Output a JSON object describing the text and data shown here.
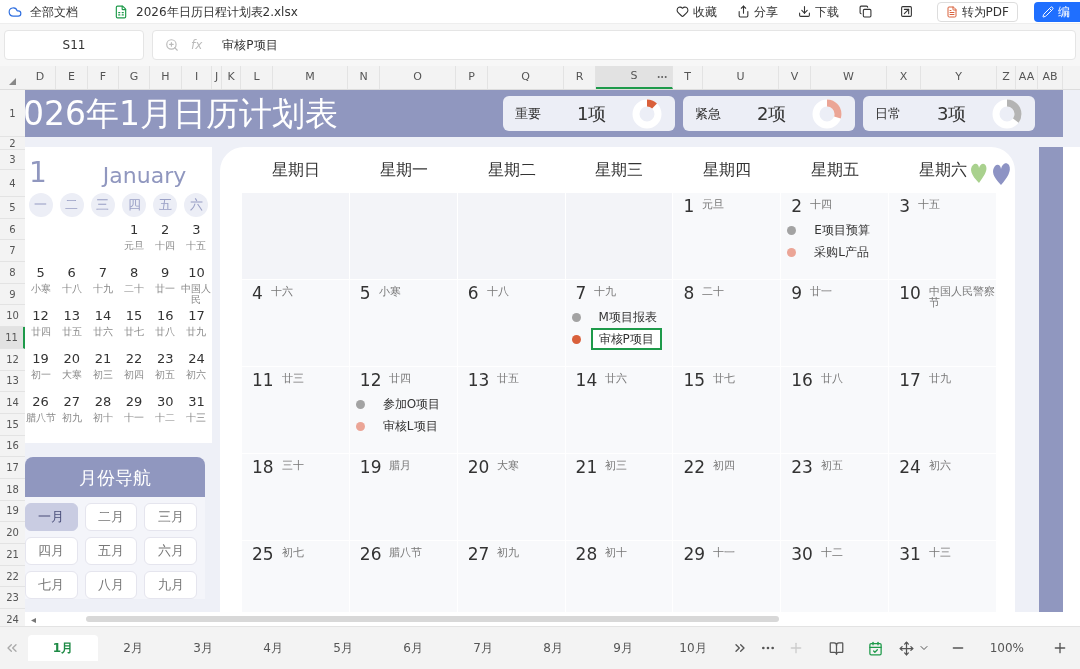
{
  "topbar": {
    "docs_label": "全部文档",
    "file_name": "2026年日历日程计划表2.xlsx",
    "actions": [
      "收藏",
      "分享",
      "下载"
    ],
    "pdf_button": "转为PDF",
    "edit_button": "编"
  },
  "formula_bar": {
    "cell": "S11",
    "fx": "fx",
    "value": "审核P项目"
  },
  "column_headers": [
    {
      "label": "D",
      "selected": false
    },
    {
      "label": "E",
      "selected": false
    },
    {
      "label": "F",
      "selected": false
    },
    {
      "label": "G",
      "selected": false
    },
    {
      "label": "H",
      "selected": false
    },
    {
      "label": "I",
      "selected": false
    },
    {
      "label": "J",
      "selected": false
    },
    {
      "label": "K",
      "selected": false
    },
    {
      "label": "L",
      "selected": false
    },
    {
      "label": "M",
      "selected": false
    },
    {
      "label": "N",
      "selected": false
    },
    {
      "label": "O",
      "selected": false
    },
    {
      "label": "P",
      "selected": false
    },
    {
      "label": "Q",
      "selected": false
    },
    {
      "label": "R",
      "selected": false
    },
    {
      "label": "S",
      "selected": true
    },
    {
      "label": "T",
      "selected": false
    },
    {
      "label": "U",
      "selected": false
    },
    {
      "label": "V",
      "selected": false
    },
    {
      "label": "W",
      "selected": false
    },
    {
      "label": "X",
      "selected": false
    },
    {
      "label": "Y",
      "selected": false
    },
    {
      "label": "Z",
      "selected": false
    },
    {
      "label": "AA",
      "selected": false
    },
    {
      "label": "AB",
      "selected": false
    }
  ],
  "row_headers": [
    {
      "label": "1",
      "selected": false
    },
    {
      "label": "2",
      "selected": false
    },
    {
      "label": "3",
      "selected": false
    },
    {
      "label": "4",
      "selected": false
    },
    {
      "label": "5",
      "selected": false
    },
    {
      "label": "6",
      "selected": false
    },
    {
      "label": "7",
      "selected": false
    },
    {
      "label": "8",
      "selected": false
    },
    {
      "label": "9",
      "selected": false
    },
    {
      "label": "10",
      "selected": false
    },
    {
      "label": "11",
      "selected": true
    },
    {
      "label": "12",
      "selected": false
    },
    {
      "label": "13",
      "selected": false
    },
    {
      "label": "14",
      "selected": false
    },
    {
      "label": "15",
      "selected": false
    },
    {
      "label": "16",
      "selected": false
    },
    {
      "label": "17",
      "selected": false
    },
    {
      "label": "18",
      "selected": false
    },
    {
      "label": "19",
      "selected": false
    },
    {
      "label": "20",
      "selected": false
    },
    {
      "label": "21",
      "selected": false
    },
    {
      "label": "22",
      "selected": false
    },
    {
      "label": "23",
      "selected": false
    },
    {
      "label": "24",
      "selected": false
    }
  ],
  "title": "026年1月日历计划表",
  "summary": [
    {
      "label": "重要",
      "count": "1项",
      "level": 0.12,
      "color": "#d9603b"
    },
    {
      "label": "紧急",
      "count": "2项",
      "level": 0.3,
      "color": "#eba596"
    },
    {
      "label": "日常",
      "count": "3项",
      "level": 0.35,
      "color": "#b4b4b4"
    }
  ],
  "mini_calendar": {
    "month_number": "1",
    "month_name": "January",
    "weekdays": [
      "一",
      "二",
      "三",
      "四",
      "五",
      "六"
    ],
    "weeks": [
      [
        {
          "day": "1",
          "lunar": "元旦"
        },
        {
          "day": "2",
          "lunar": "十四"
        },
        {
          "day": "3",
          "lunar": "十五"
        }
      ],
      [
        {
          "day": "5",
          "lunar": "小寒"
        },
        {
          "day": "6",
          "lunar": "十八"
        },
        {
          "day": "7",
          "lunar": "十九"
        },
        {
          "day": "8",
          "lunar": "二十"
        },
        {
          "day": "9",
          "lunar": "廿一"
        },
        {
          "day": "10",
          "lunar": "中国人民"
        }
      ],
      [
        {
          "day": "12",
          "lunar": "廿四"
        },
        {
          "day": "13",
          "lunar": "廿五"
        },
        {
          "day": "14",
          "lunar": "廿六"
        },
        {
          "day": "15",
          "lunar": "廿七"
        },
        {
          "day": "16",
          "lunar": "廿八"
        },
        {
          "day": "17",
          "lunar": "廿九"
        }
      ],
      [
        {
          "day": "19",
          "lunar": "初一"
        },
        {
          "day": "20",
          "lunar": "大寒"
        },
        {
          "day": "21",
          "lunar": "初三"
        },
        {
          "day": "22",
          "lunar": "初四"
        },
        {
          "day": "23",
          "lunar": "初五"
        },
        {
          "day": "24",
          "lunar": "初六"
        }
      ],
      [
        {
          "day": "26",
          "lunar": "腊八节"
        },
        {
          "day": "27",
          "lunar": "初九"
        },
        {
          "day": "28",
          "lunar": "初十"
        },
        {
          "day": "29",
          "lunar": "十一"
        },
        {
          "day": "30",
          "lunar": "十二"
        },
        {
          "day": "31",
          "lunar": "十三"
        }
      ]
    ]
  },
  "month_nav": {
    "title": "月份导航",
    "months": [
      {
        "label": "一月",
        "selected": true
      },
      {
        "label": "二月",
        "selected": false
      },
      {
        "label": "三月",
        "selected": false
      },
      {
        "label": "四月",
        "selected": false
      },
      {
        "label": "五月",
        "selected": false
      },
      {
        "label": "六月",
        "selected": false
      },
      {
        "label": "七月",
        "selected": false
      },
      {
        "label": "八月",
        "selected": false
      },
      {
        "label": "九月",
        "selected": false
      }
    ]
  },
  "calendar": {
    "weekdays": [
      "星期日",
      "星期一",
      "星期二",
      "星期三",
      "星期四",
      "星期五",
      "星期六"
    ],
    "weeks": [
      [
        {
          "day": "1",
          "lunar": "元旦"
        },
        {
          "day": "2",
          "lunar": "十四",
          "events": [
            {
              "text": "E项目预算",
              "color": "#a3a3a3",
              "selected": false
            },
            {
              "text": "采购L产品",
              "color": "#eba596",
              "selected": false
            }
          ]
        },
        {
          "day": "3",
          "lunar": "十五"
        }
      ],
      [
        {
          "day": "4",
          "lunar": "十六"
        },
        {
          "day": "5",
          "lunar": "小寒"
        },
        {
          "day": "6",
          "lunar": "十八"
        },
        {
          "day": "7",
          "lunar": "十九",
          "events": [
            {
              "text": "M项目报表",
              "color": "#a3a3a3",
              "selected": false
            },
            {
              "text": "审核P项目",
              "color": "#d9603b",
              "selected": true
            }
          ]
        },
        {
          "day": "8",
          "lunar": "二十"
        },
        {
          "day": "9",
          "lunar": "廿一"
        },
        {
          "day": "10",
          "lunar": "中国人民警察节"
        }
      ],
      [
        {
          "day": "11",
          "lunar": "廿三"
        },
        {
          "day": "12",
          "lunar": "廿四",
          "events": [
            {
              "text": "参加O项目",
              "color": "#a3a3a3",
              "selected": false
            },
            {
              "text": "审核L项目",
              "color": "#eba596",
              "selected": false
            }
          ]
        },
        {
          "day": "13",
          "lunar": "廿五"
        },
        {
          "day": "14",
          "lunar": "廿六"
        },
        {
          "day": "15",
          "lunar": "廿七"
        },
        {
          "day": "16",
          "lunar": "廿八"
        },
        {
          "day": "17",
          "lunar": "廿九"
        }
      ],
      [
        {
          "day": "18",
          "lunar": "三十"
        },
        {
          "day": "19",
          "lunar": "腊月"
        },
        {
          "day": "20",
          "lunar": "大寒"
        },
        {
          "day": "21",
          "lunar": "初三"
        },
        {
          "day": "22",
          "lunar": "初四"
        },
        {
          "day": "23",
          "lunar": "初五"
        },
        {
          "day": "24",
          "lunar": "初六"
        }
      ],
      [
        {
          "day": "25",
          "lunar": "初七"
        },
        {
          "day": "26",
          "lunar": "腊八节"
        },
        {
          "day": "27",
          "lunar": "初九"
        },
        {
          "day": "28",
          "lunar": "初十"
        },
        {
          "day": "29",
          "lunar": "十一"
        },
        {
          "day": "30",
          "lunar": "十二"
        },
        {
          "day": "31",
          "lunar": "十三"
        }
      ]
    ]
  },
  "sheet_tabs": [
    {
      "label": "1月",
      "selected": true
    },
    {
      "label": "2月",
      "selected": false
    },
    {
      "label": "3月",
      "selected": false
    },
    {
      "label": "4月",
      "selected": false
    },
    {
      "label": "5月",
      "selected": false
    },
    {
      "label": "6月",
      "selected": false
    },
    {
      "label": "7月",
      "selected": false
    },
    {
      "label": "8月",
      "selected": false
    },
    {
      "label": "9月",
      "selected": false
    },
    {
      "label": "10月",
      "selected": false
    }
  ],
  "scroll_left": "◂",
  "zoom": "100%"
}
